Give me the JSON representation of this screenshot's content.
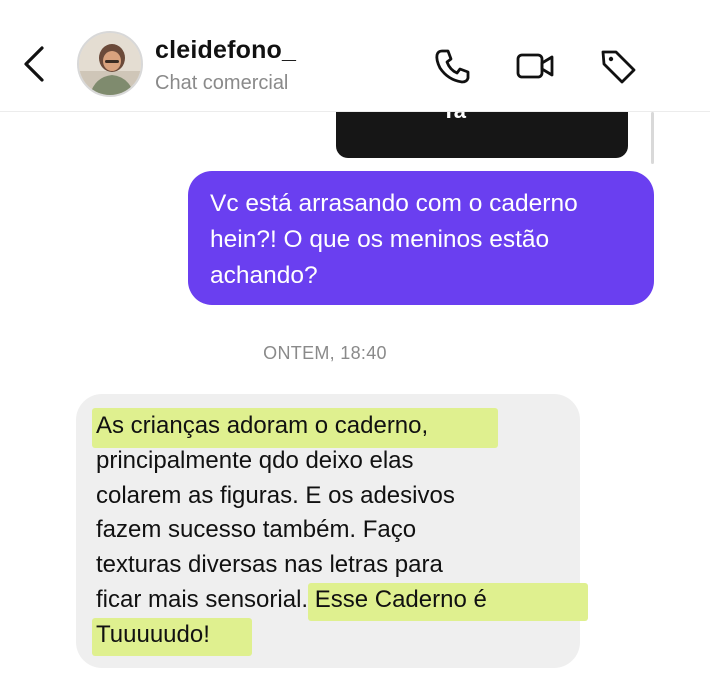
{
  "header": {
    "username": "cleidefono_",
    "subtitle": "Chat comercial",
    "actions": [
      "phone-icon",
      "video-icon",
      "tag-icon"
    ]
  },
  "messages": {
    "media_fragment": "Ta",
    "outgoing": {
      "lines": [
        "Vc está arrasando com o caderno",
        "hein?! O que os meninos estão",
        "achando?"
      ]
    },
    "timestamp": "ONTEM, 18:40",
    "incoming": {
      "lines": [
        "As crianças adoram o caderno,",
        "principalmente qdo deixo elas",
        "colarem as figuras.  E os adesivos",
        "fazem sucesso também.  Faço",
        "texturas diversas nas letras para",
        "ficar mais sensorial.  Esse Caderno é",
        "Tuuuuudo!"
      ],
      "highlight_color": "#dff08f"
    }
  },
  "colors": {
    "outgoing_bubble": "#6a3ff0",
    "incoming_bubble": "#efefef",
    "subtitle": "#8a8a8a"
  }
}
